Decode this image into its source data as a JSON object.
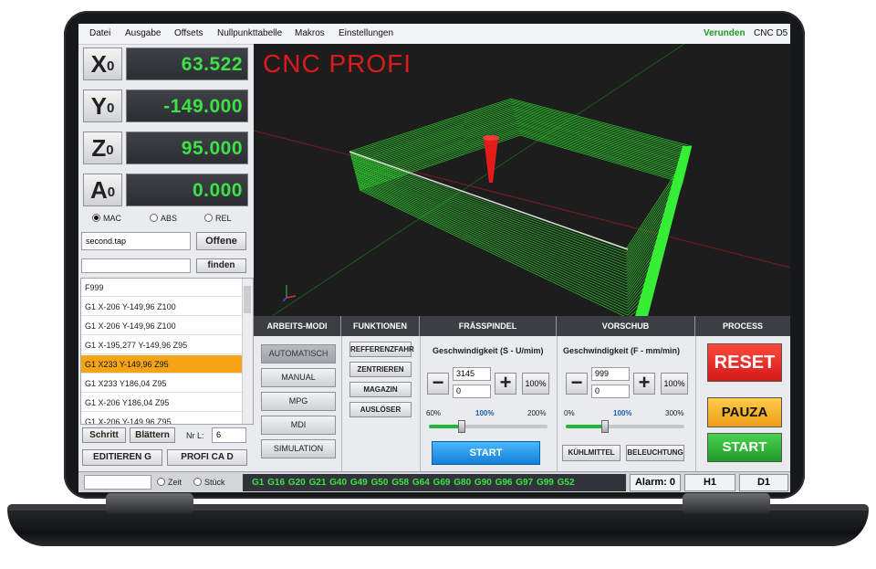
{
  "menu": {
    "items": [
      "Datei",
      "Ausgabe",
      "Offsets",
      "Nullpunkttabelle",
      "Makros",
      "Einstellungen"
    ],
    "status": "Verunden",
    "app": "CNC D5"
  },
  "dro": {
    "axes": [
      {
        "letter": "X",
        "sub": "0",
        "value": "63.522"
      },
      {
        "letter": "Y",
        "sub": "0",
        "value": "-149.000"
      },
      {
        "letter": "Z",
        "sub": "0",
        "value": "95.000"
      },
      {
        "letter": "A",
        "sub": "0",
        "value": "0.000"
      }
    ],
    "modes": [
      "MAC",
      "ABS",
      "REL"
    ],
    "selected_mode": "MAC"
  },
  "file": {
    "name": "second.tap",
    "open_label": "Offene",
    "search_value": "",
    "find_label": "finden"
  },
  "gcode_list": {
    "lines": [
      "F999",
      "G1 X-206 Y-149,96 Z100",
      "G1 X-206 Y-149,96 Z100",
      "G1 X-195,277 Y-149,96 Z95",
      "G1 X233 Y-149,96 Z95",
      "G1 X233 Y186,04 Z95",
      "G1 X-206 Y186,04 Z95",
      "G1 X-206 Y-149,96 Z95"
    ],
    "selected_index": 4
  },
  "list_controls": {
    "step_label": "Schritt",
    "page_label": "Blättern",
    "line_label": "Nr L:",
    "line_value": "6",
    "edit_label": "EDITIEREN G",
    "profi_label": "PROFI CA D"
  },
  "viewport": {
    "title": "CNC PROFI"
  },
  "sections": {
    "modes_title": "ARBEITS-MODI",
    "functions_title": "FUNKTIONEN",
    "spindle_title": "FRÄSSPINDEL",
    "feed_title": "VORSCHUB",
    "process_title": "PROCESS"
  },
  "modes": [
    "AUTOMATISCH",
    "MANUAL",
    "MPG",
    "MDI",
    "SIMULATION"
  ],
  "active_mode": "AUTOMATISCH",
  "functions": [
    "REFFERENZFAHR",
    "ZENTRIEREN",
    "MAGAZIN",
    "AUSLÖSER"
  ],
  "spindle": {
    "label": "Geschwindigkeit (S - U/mim)",
    "value": "3145",
    "override": "0",
    "pct_button": "100%",
    "min": "60%",
    "mid": "100%",
    "max": "200%",
    "slider_fraction": 0.28,
    "start_label": "START"
  },
  "feed": {
    "label": "Geschwindigkeit (F - mm/min)",
    "value": "999",
    "override": "0",
    "pct_button": "100%",
    "min": "0%",
    "mid": "100%",
    "max": "300%",
    "slider_fraction": 0.33,
    "coolant_label": "KÜHLMITTEL",
    "light_label": "BELEUCHTUNG"
  },
  "process": {
    "reset_label": "RESET",
    "pause_label": "PAUZA",
    "start_label": "START"
  },
  "status": {
    "time_label": "Zeit",
    "count_label": "Stück",
    "gcodes": "G1 G16 G20 G21 G40 G49 G50 G58 G64 G69 G80 G90 G96 G97 G99 G52",
    "alarm": "Alarm: 0",
    "h": "H1",
    "d": "D1"
  },
  "colors": {
    "dro_green": "#3ee045",
    "selected_row": "#f5a415",
    "reset": "#e82020",
    "pause": "#f2b12a",
    "start": "#33b83a"
  }
}
